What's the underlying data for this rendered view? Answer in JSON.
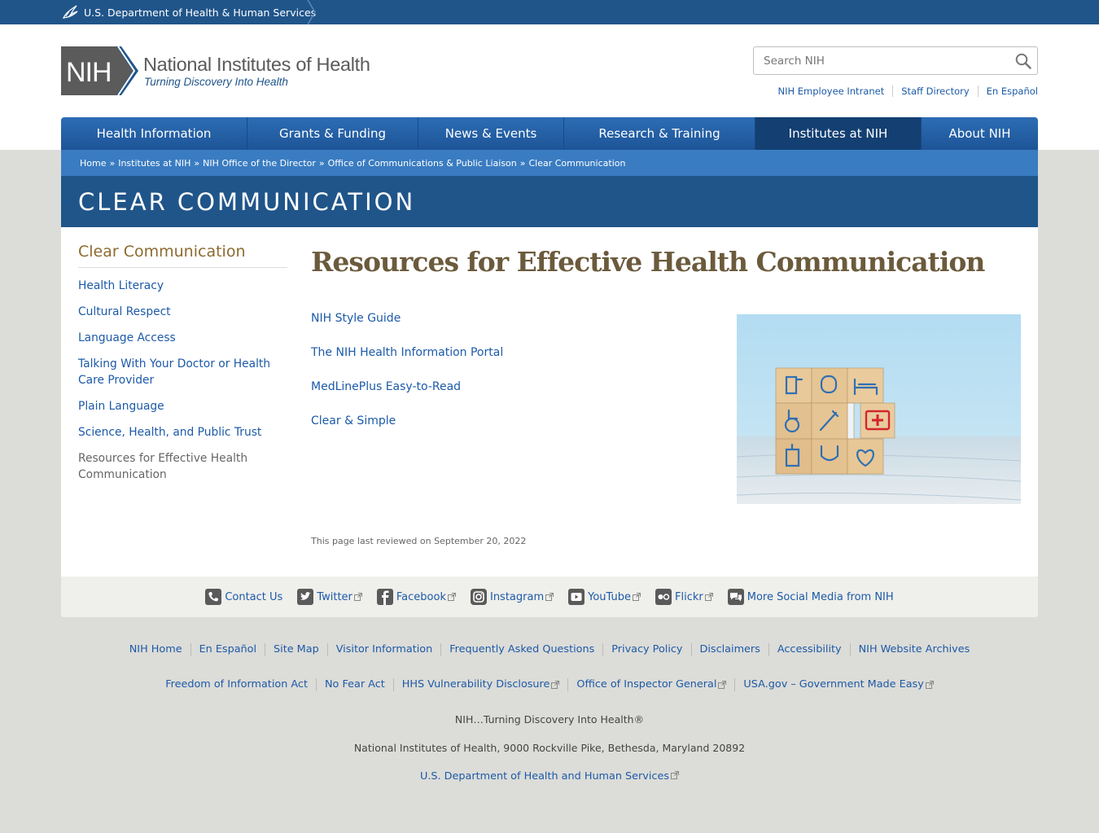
{
  "hhs_bar": {
    "label": "U.S. Department of Health & Human Services"
  },
  "header": {
    "logo_mark": "NIH",
    "logo_title": "National Institutes of Health",
    "logo_tagline": "Turning Discovery Into Health",
    "search_placeholder": "Search NIH",
    "util_links": [
      "NIH Employee Intranet",
      "Staff Directory",
      "En Español"
    ]
  },
  "nav": [
    {
      "label": "Health Information"
    },
    {
      "label": "Grants & Funding"
    },
    {
      "label": "News & Events"
    },
    {
      "label": "Research & Training"
    },
    {
      "label": "Institutes at NIH",
      "active": true
    },
    {
      "label": "About NIH"
    }
  ],
  "breadcrumb": [
    "Home",
    "Institutes at NIH",
    "NIH Office of the Director",
    "Office of Communications & Public Liaison",
    "Clear Communication"
  ],
  "banner_title": "CLEAR COMMUNICATION",
  "sidebar": {
    "title": "Clear Communication",
    "items": [
      "Health Literacy",
      "Cultural Respect",
      "Language Access",
      "Talking With Your Doctor or Health Care Provider",
      "Plain Language",
      "Science, Health, and Public Trust",
      "Resources for Effective Health Communication"
    ]
  },
  "main": {
    "title": "Resources for Effective Health Communication",
    "resources": [
      "NIH Style Guide",
      "The NIH Health Information Portal",
      "MedLinePlus Easy-to-Read",
      "Clear & Simple"
    ],
    "reviewed": "This page last reviewed on September 20, 2022"
  },
  "social": [
    {
      "label": "Contact Us",
      "icon": "phone-icon"
    },
    {
      "label": "Twitter",
      "icon": "twitter-icon",
      "external": true
    },
    {
      "label": "Facebook",
      "icon": "facebook-icon",
      "external": true
    },
    {
      "label": "Instagram",
      "icon": "instagram-icon",
      "external": true
    },
    {
      "label": "YouTube",
      "icon": "youtube-icon",
      "external": true
    },
    {
      "label": "Flickr",
      "icon": "flickr-icon",
      "external": true
    },
    {
      "label": "More Social Media from NIH",
      "icon": "social-media-icon"
    }
  ],
  "footer": {
    "row1": [
      "NIH Home",
      "En Español",
      "Site Map",
      "Visitor Information",
      "Frequently Asked Questions",
      "Privacy Policy",
      "Disclaimers",
      "Accessibility",
      "NIH Website Archives"
    ],
    "row2": [
      {
        "label": "Freedom of Information Act"
      },
      {
        "label": "No Fear Act"
      },
      {
        "label": "HHS Vulnerability Disclosure",
        "external": true
      },
      {
        "label": "Office of Inspector General",
        "external": true
      },
      {
        "label": "USA.gov – Government Made Easy",
        "external": true
      }
    ],
    "tagline": "NIH…Turning Discovery Into Health®",
    "address": "National Institutes of Health, 9000 Rockville Pike, Bethesda, Maryland 20892",
    "hhs_link": "U.S. Department of Health and Human Services"
  },
  "colors": {
    "hhs_bar": "#20558a",
    "nav": "#2d6db4",
    "breadcrumb": "#3a7cc1",
    "banner": "#20558a",
    "sidebar_title": "#8c6a2f",
    "link": "#1c5aa8"
  }
}
